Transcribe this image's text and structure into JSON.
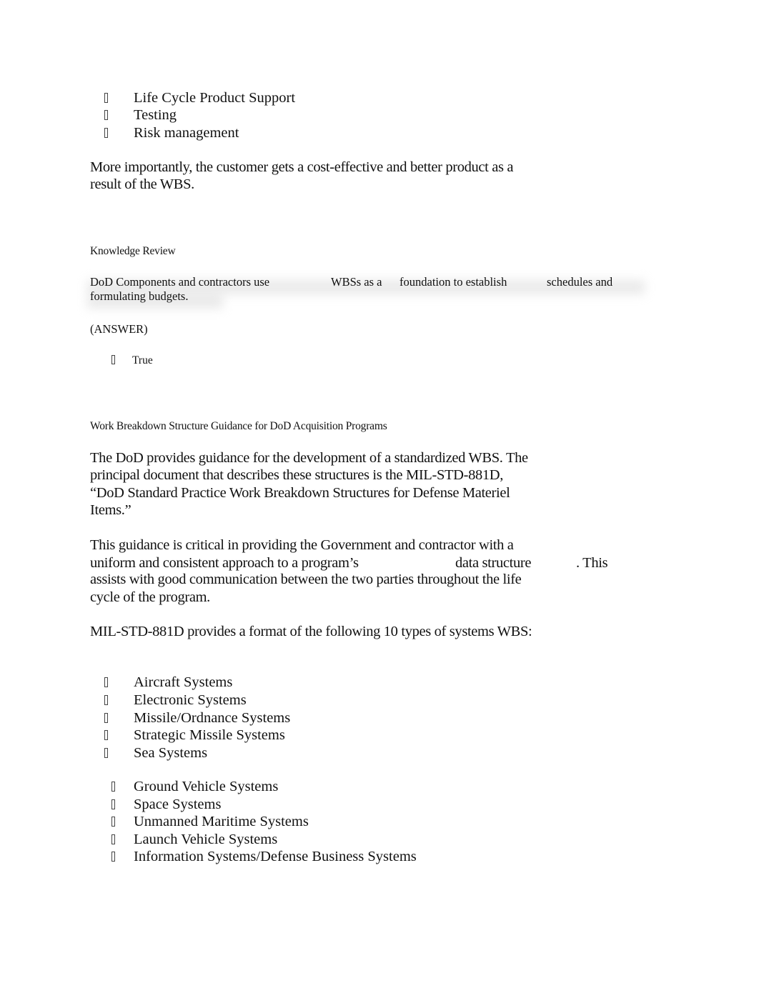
{
  "list_top": {
    "items": [
      "Life Cycle Product Support",
      "Testing",
      "Risk management"
    ]
  },
  "paragraph_customer": {
    "lines": [
      "More importantly, the customer gets a cost-effective and better product as a",
      "result of the WBS."
    ]
  },
  "knowledge_review": {
    "heading": "Knowledge Review",
    "statement_segments": [
      "DoD Components and contractors use",
      "WBSs as a",
      "foundation to establish",
      "schedules and"
    ],
    "statement_line2": "formulating budgets.",
    "answer_label": "(ANSWER)",
    "answer_option": "True"
  },
  "guidance_section": {
    "heading": "Work Breakdown Structure Guidance for DoD Acquisition Programs",
    "paragraph1": [
      "The DoD provides guidance for the development of a standardized WBS. The",
      "principal document that describes these structures is the MIL-STD-881D,",
      "“DoD Standard Practice Work Breakdown Structures for Defense Materiel",
      "Items.”"
    ],
    "paragraph2": {
      "line1": "This guidance is critical in providing the Government and contractor with a",
      "line2_a": "uniform and consistent approach to a program’s",
      "line2_b": "data structure",
      "line2_c": ". This",
      "line3": "assists with good communication between the two parties throughout the life",
      "line4": "cycle of the program."
    },
    "paragraph3": "MIL-STD-881D provides a format of the following 10 types of systems WBS:",
    "systems_group1": [
      "Aircraft Systems",
      "Electronic Systems",
      "Missile/Ordnance Systems",
      "Strategic Missile Systems",
      "Sea Systems"
    ],
    "systems_group2": [
      "Ground Vehicle Systems",
      "Space Systems",
      "Unmanned Maritime Systems",
      "Launch Vehicle Systems",
      "Information Systems/Defense Business Systems"
    ]
  },
  "icons": {
    "bullet": "missing-glyph-box"
  }
}
